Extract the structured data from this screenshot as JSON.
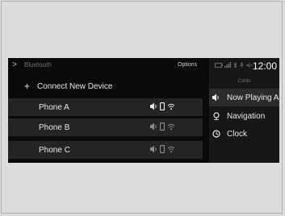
{
  "bluetooth_panel": {
    "title": "Bluetooth",
    "options_label": "Options",
    "connect_label": "Connect New Device",
    "devices": [
      {
        "name": "Phone A"
      },
      {
        "name": "Phone B"
      },
      {
        "name": "Phone C"
      }
    ]
  },
  "right_panel": {
    "time": "12:00",
    "cards_heading": "Cards",
    "cards": [
      {
        "label": "Now Playing Audio",
        "icon": "speaker-icon"
      },
      {
        "label": "Navigation",
        "icon": "navigation-pin-icon"
      },
      {
        "label": "Clock",
        "icon": "clock-icon"
      }
    ]
  },
  "colors": {
    "background": "#dcdcdc",
    "screen": "#0a0a0a",
    "row_highlight": "#242424",
    "card_highlight": "#2b2b2b",
    "text": "#e8e8e8",
    "muted_text": "#6f6f6f"
  }
}
